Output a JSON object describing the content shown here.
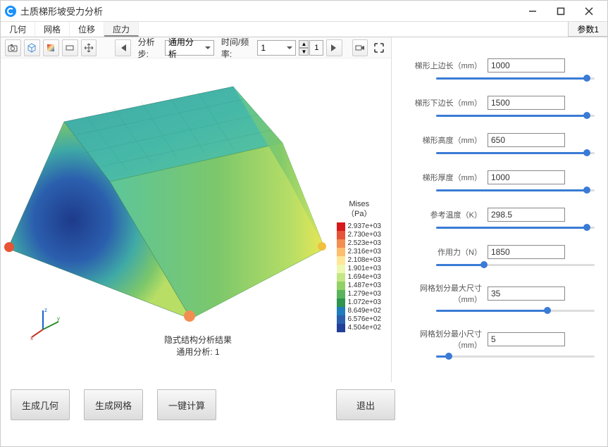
{
  "window": {
    "title": "土质梯形坡受力分析"
  },
  "tabs": {
    "items": [
      "几何",
      "网格",
      "位移",
      "应力"
    ],
    "active_index": 3,
    "right_tab": "参数1"
  },
  "toolbar": {
    "step_label": "分析步:",
    "step_combo": "通用分析",
    "time_label": "时间/频率:",
    "time_combo": "1",
    "stepper_value": "1"
  },
  "legend": {
    "title_l1": "Mises",
    "title_l2": "（Pa）",
    "values": [
      "2.937e+03",
      "2.730e+03",
      "2.523e+03",
      "2.316e+03",
      "2.108e+03",
      "1.901e+03",
      "1.694e+03",
      "1.487e+03",
      "1.279e+03",
      "1.072e+03",
      "8.649e+02",
      "6.576e+02",
      "4.504e+02"
    ],
    "colors": [
      "#d7191c",
      "#e75437",
      "#f38e52",
      "#fdbe6e",
      "#fee79a",
      "#eef8b2",
      "#c4e687",
      "#93d168",
      "#5ab45e",
      "#2f944e",
      "#1f7cbd",
      "#2b5fae",
      "#233f9a"
    ]
  },
  "canvas": {
    "footer_l1": "隐式结构分析结果",
    "footer_l2": "通用分析: 1"
  },
  "params": [
    {
      "label": "梯形上边长（mm）",
      "value": "1000",
      "pos": 95
    },
    {
      "label": "梯形下边长（mm）",
      "value": "1500",
      "pos": 95
    },
    {
      "label": "梯形高度（mm）",
      "value": "650",
      "pos": 95
    },
    {
      "label": "梯形厚度（mm）",
      "value": "1000",
      "pos": 95
    },
    {
      "label": "参考温度（K）",
      "value": "298.5",
      "pos": 95
    },
    {
      "label": "作用力（N）",
      "value": "1850",
      "pos": 30
    },
    {
      "label": "网格划分最大尺寸（mm）",
      "value": "35",
      "pos": 70
    },
    {
      "label": "网格划分最小尺寸（mm）",
      "value": "5",
      "pos": 8
    }
  ],
  "buttons": {
    "gen_geom": "生成几何",
    "gen_mesh": "生成网格",
    "compute": "一键计算",
    "exit": "退出"
  }
}
